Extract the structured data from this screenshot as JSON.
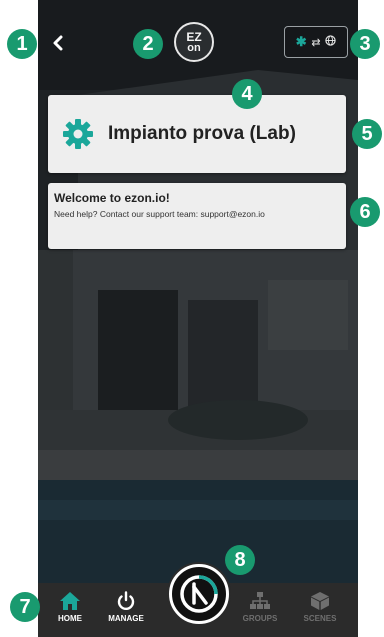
{
  "header": {
    "logo_line1": "EZ",
    "logo_line2": "on"
  },
  "status": {
    "bluetooth_icon": "bluetooth-icon",
    "sync_icon": "sync-icon",
    "globe_icon": "globe-icon"
  },
  "plant_card": {
    "name": "Impianto prova (Lab)",
    "icon": "gear-icon",
    "icon_color": "#1ba79a"
  },
  "welcome_card": {
    "title": "Welcome to ezon.io!",
    "help_text": "Need help? Contact our support team: support@ezon.io"
  },
  "nav": {
    "home_label": "HOME",
    "manage_label": "MANAGE",
    "groups_label": "GROUPS",
    "scenes_label": "SCENES",
    "active_color": "#ffffff",
    "inactive_color": "#6f6f6f"
  },
  "markers": [
    "1",
    "2",
    "3",
    "4",
    "5",
    "6",
    "7",
    "8"
  ],
  "colors": {
    "marker": "#199a6f",
    "accent": "#1ba79a",
    "card": "#eeeeee"
  }
}
